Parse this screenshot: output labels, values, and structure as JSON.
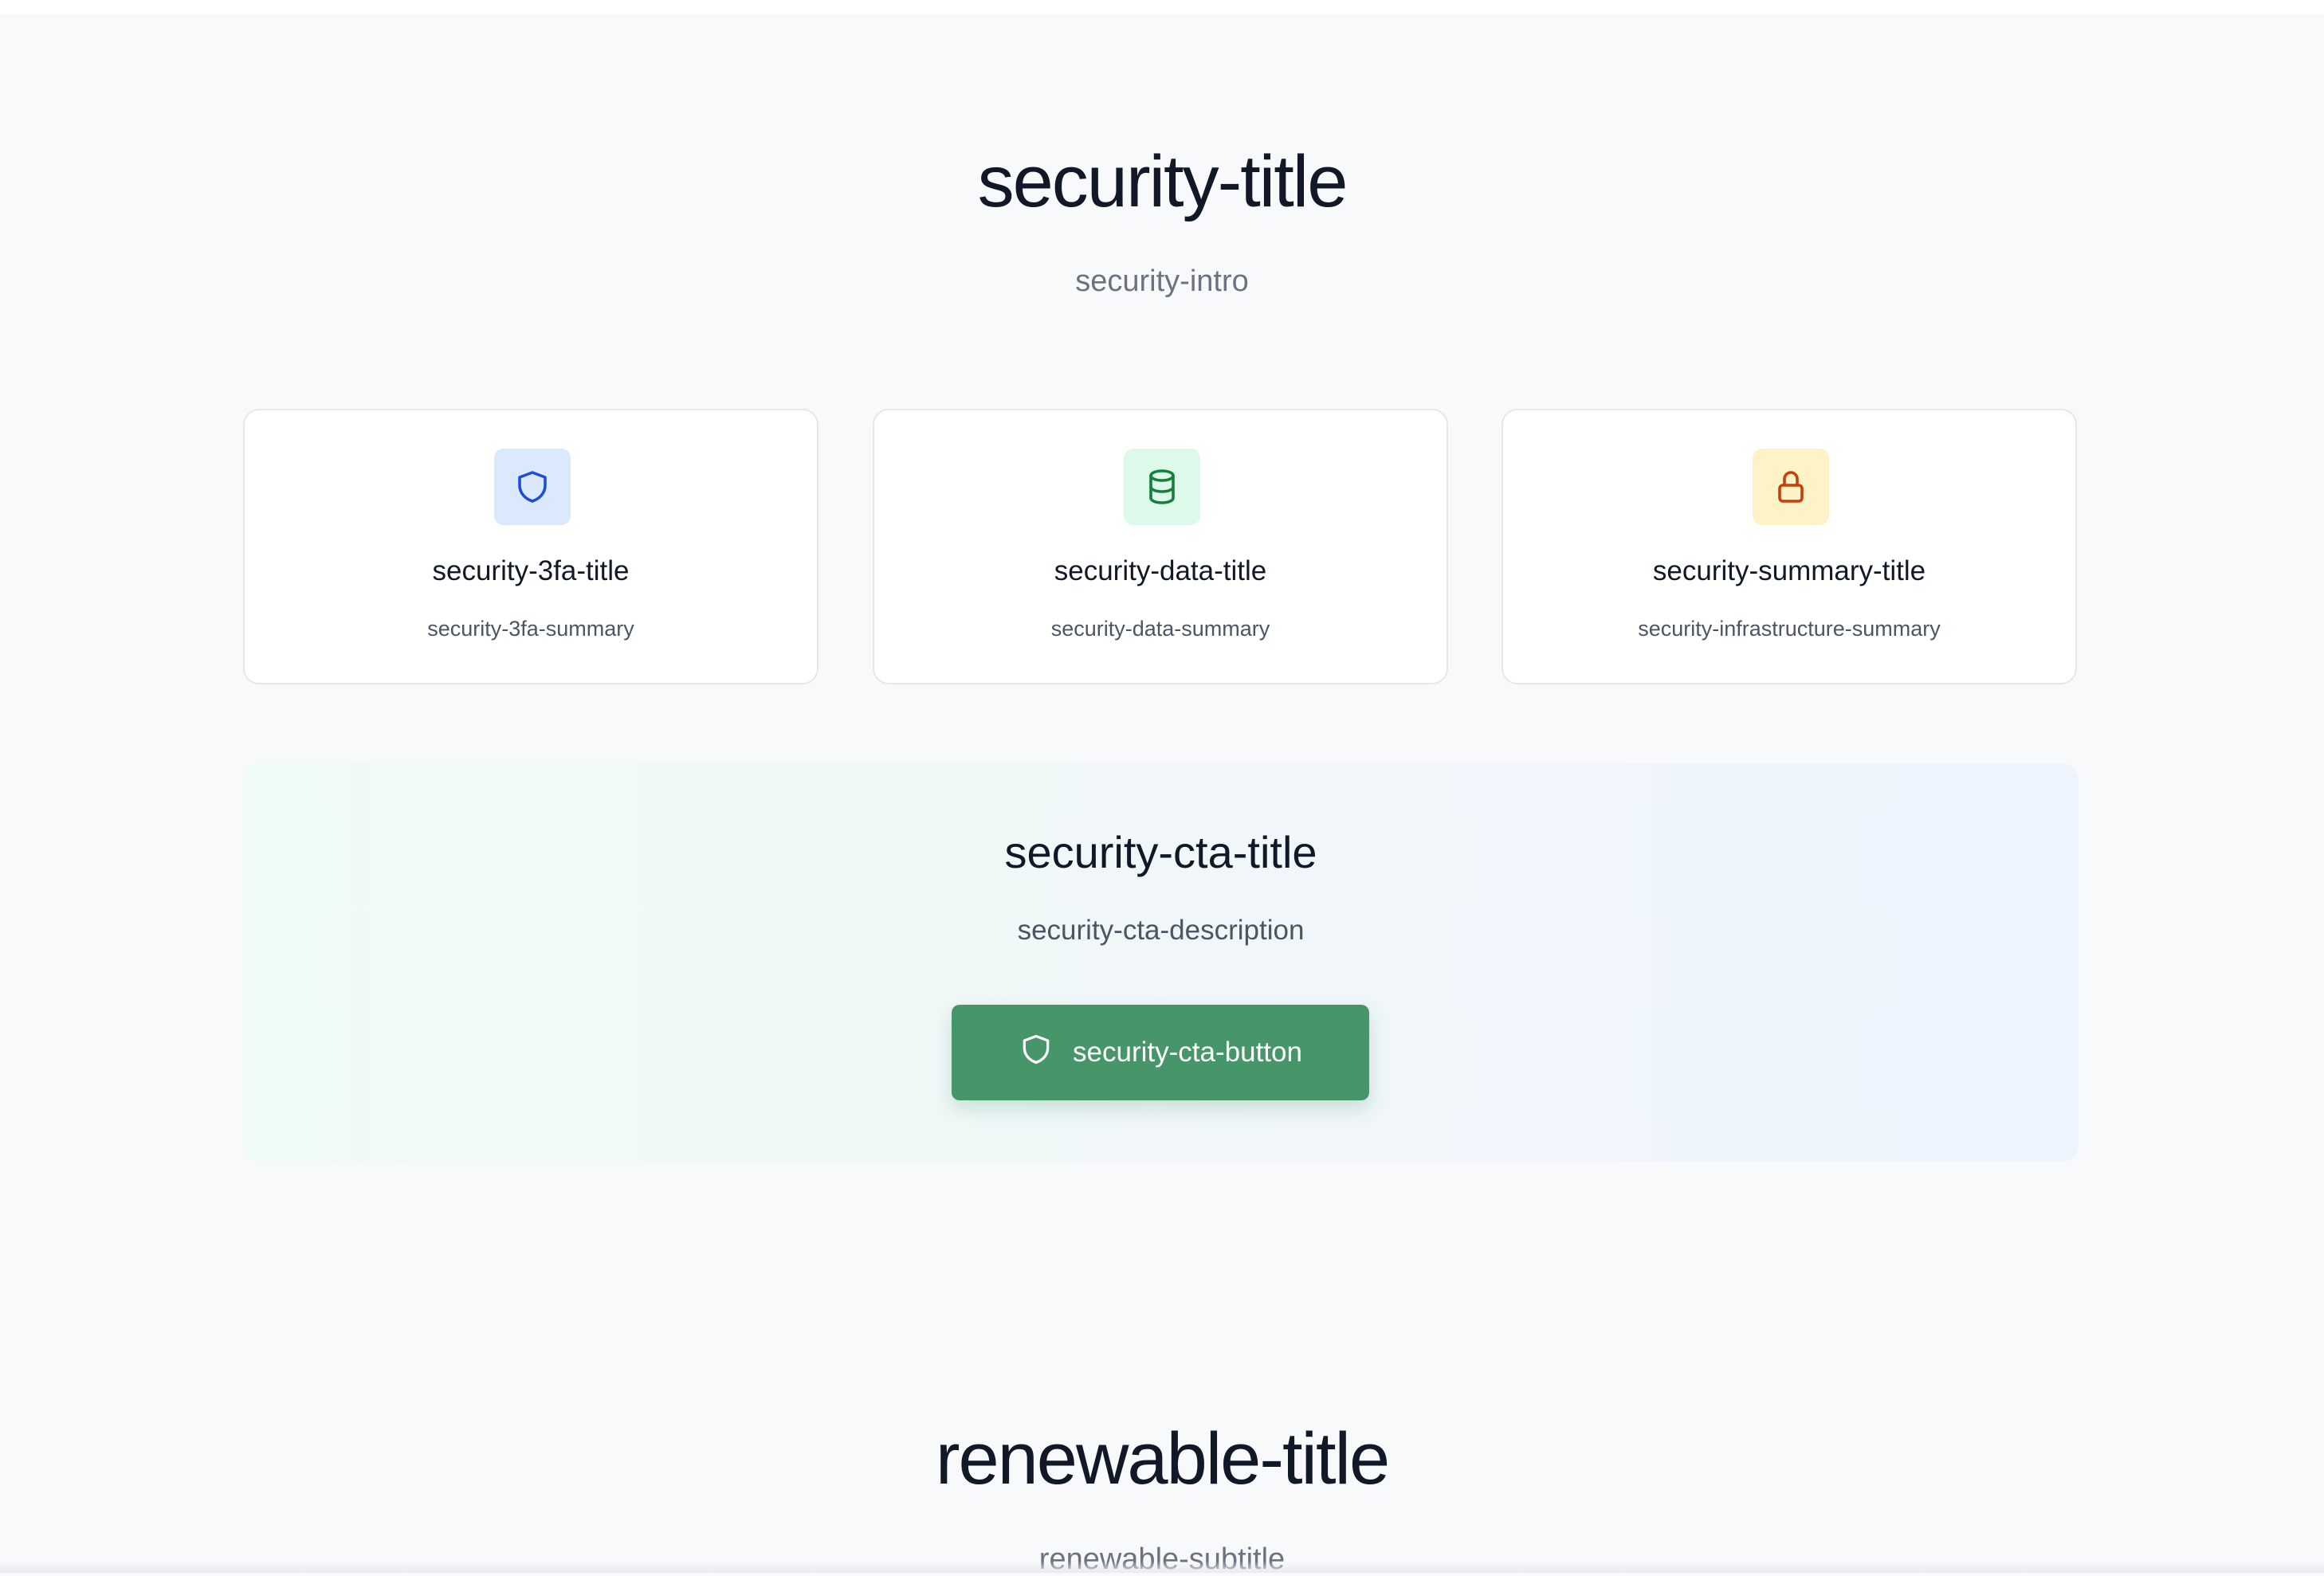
{
  "security": {
    "title": "security-title",
    "intro": "security-intro",
    "cards": [
      {
        "icon": "shield-icon",
        "title": "security-3fa-title",
        "summary": "security-3fa-summary",
        "icon_bg": "#dce8fb",
        "icon_color": "#1d4ed8"
      },
      {
        "icon": "database-icon",
        "title": "security-data-title",
        "summary": "security-data-summary",
        "icon_bg": "#dcf9ea",
        "icon_color": "#15803d"
      },
      {
        "icon": "lock-icon",
        "title": "security-summary-title",
        "summary": "security-infrastructure-summary",
        "icon_bg": "#fef3c7",
        "icon_color": "#c2410c"
      }
    ],
    "cta": {
      "title": "security-cta-title",
      "description": "security-cta-description",
      "button_label": "security-cta-button",
      "button_icon": "shield-icon",
      "button_color": "#47966a"
    }
  },
  "renewable": {
    "title": "renewable-title",
    "subtitle": "renewable-subtitle"
  }
}
